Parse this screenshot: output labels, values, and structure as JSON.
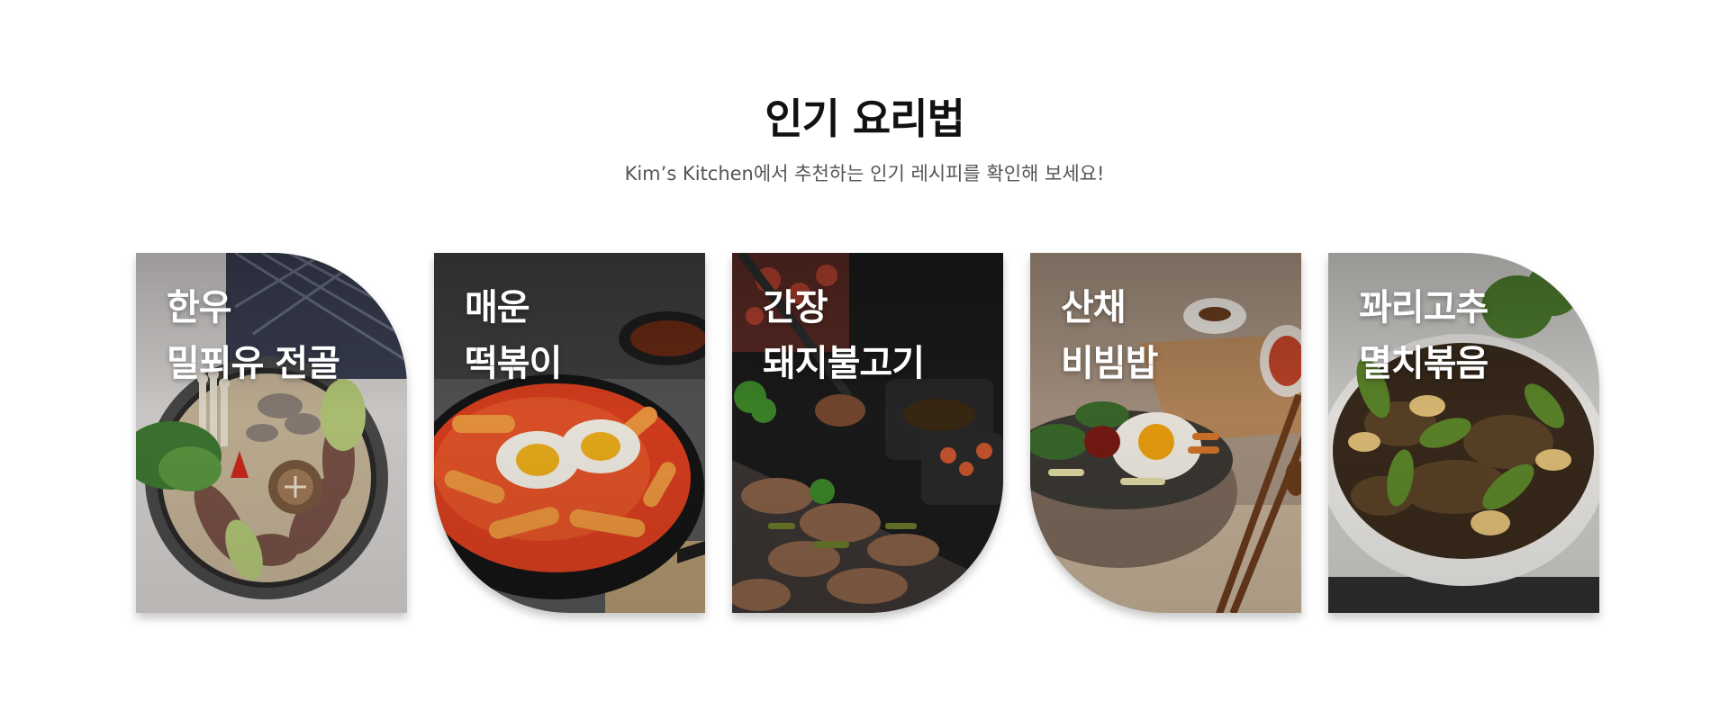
{
  "section": {
    "title": "인기 요리법",
    "subtitle": "Kim’s Kitchen에서 추천하는 인기 레시피를 확인해 보세요!"
  },
  "recipes": [
    {
      "line1": "한우",
      "line2": "밀푀유 전골",
      "image": "hanwoo-millefeuille-hotpot-photo"
    },
    {
      "line1": "매운",
      "line2": "떡볶이",
      "image": "spicy-tteokbokki-photo"
    },
    {
      "line1": "간장",
      "line2": "돼지불고기",
      "image": "soy-pork-bulgogi-photo"
    },
    {
      "line1": "산채",
      "line2": "비빔밥",
      "image": "wild-greens-bibimbap-photo"
    },
    {
      "line1": "꽈리고추",
      "line2": "멸치볶음",
      "image": "shishito-anchovy-stirfry-photo"
    }
  ],
  "colors": {
    "background": "#ffffff",
    "title": "#111111",
    "subtitle": "#555555",
    "card_text": "#ffffff"
  }
}
